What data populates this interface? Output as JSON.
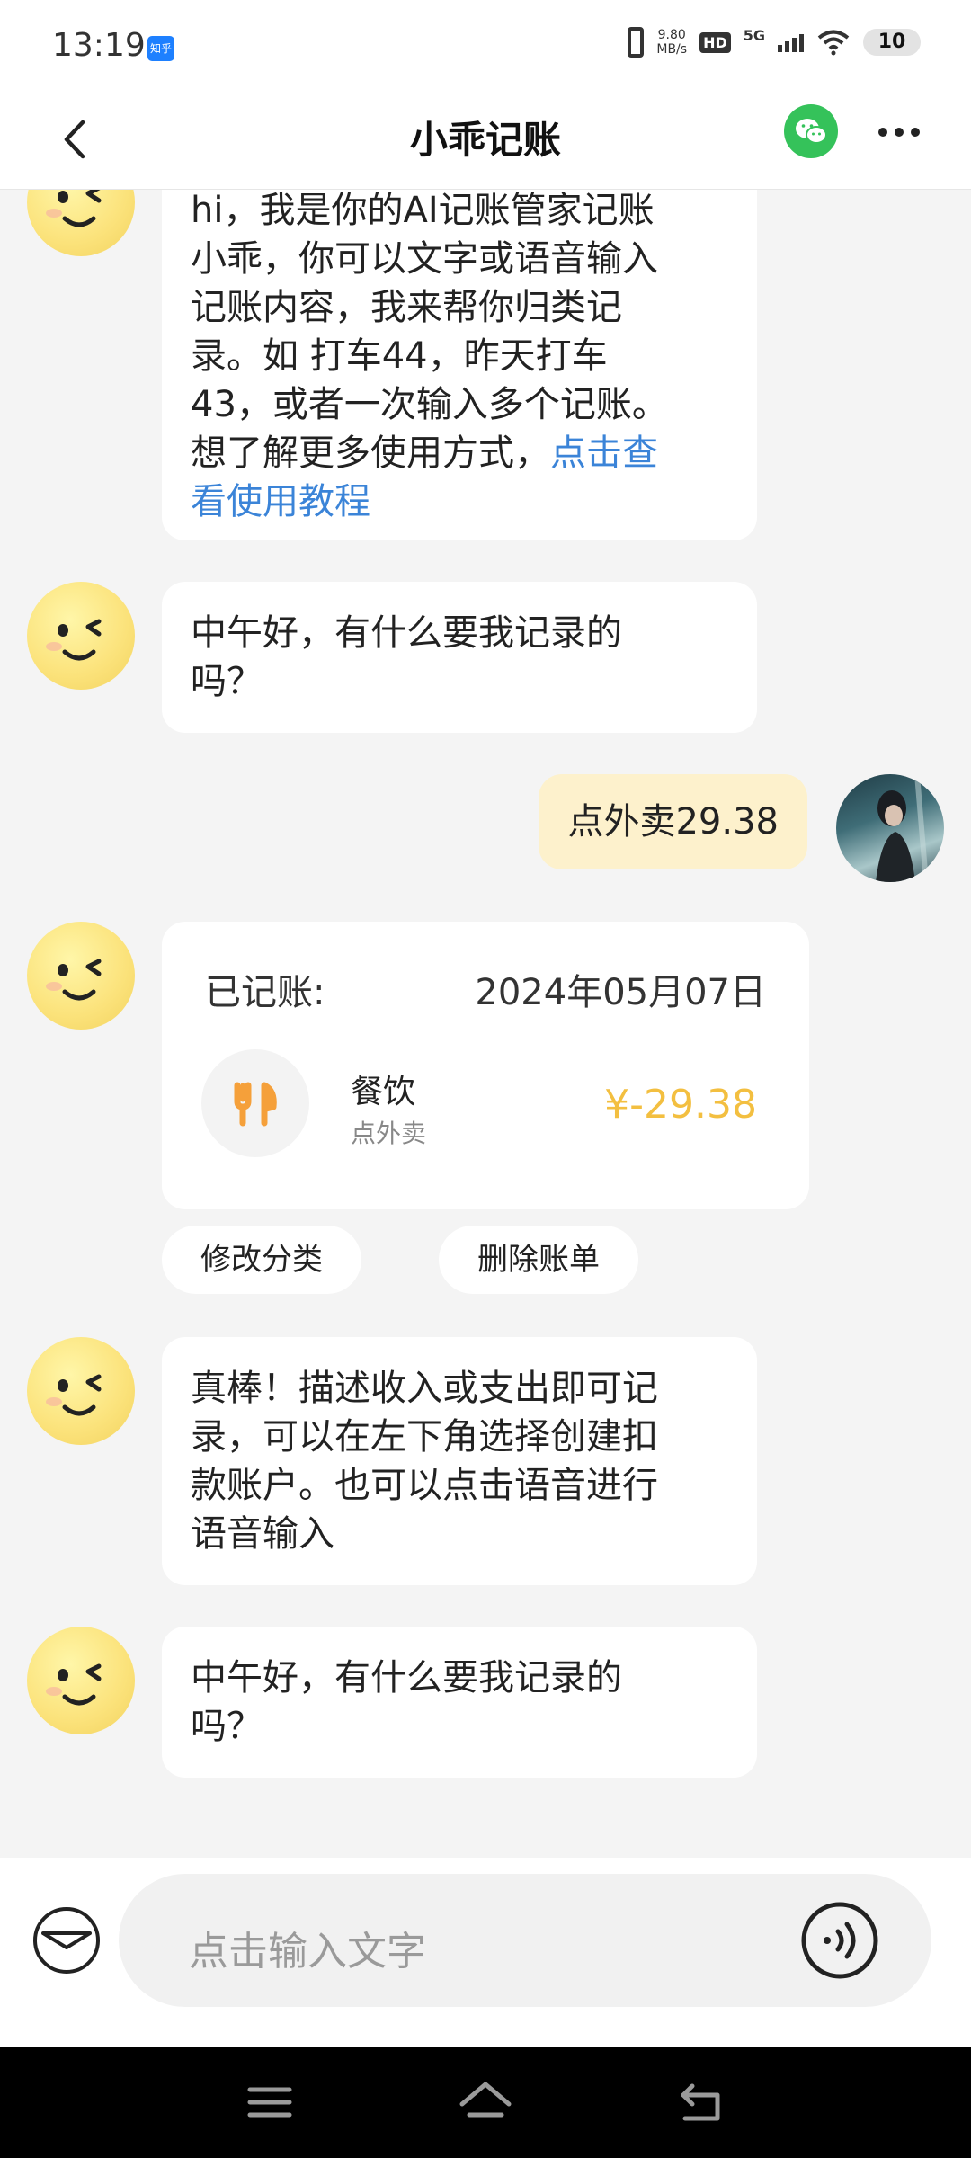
{
  "status_bar": {
    "time": "13:19",
    "app_badge": "知乎",
    "speed": "9.80",
    "speed_unit": "MB/s",
    "hd": "HD",
    "network": "5G",
    "battery": "10"
  },
  "header": {
    "title": "小乖记账",
    "icons": {
      "back": "chevron-left-icon",
      "share": "wechat-icon",
      "more": "more-dots-icon"
    }
  },
  "messages": {
    "intro": {
      "lines": [
        "hi，我是你的AI记账管家记账",
        "小乖，你可以文字或语音输入",
        "记账内容，我来帮你归类记",
        "录。如 打车44，昨天打车",
        "43，或者一次输入多个记账。"
      ],
      "last_line_prefix": "想了解更多使用方式，",
      "link_part1": "点击查",
      "link_part2": "看使用教程"
    },
    "greeting1": [
      "中午好，有什么要我记录的",
      "吗？"
    ],
    "user_msg": "点外卖29.38",
    "record_card": {
      "label": "已记账:",
      "date": "2024年05月07日",
      "category": "餐饮",
      "note": "点外卖",
      "amount": "¥-29.38",
      "amount_color": "#f3bf40",
      "category_icon": "fork-knife-icon"
    },
    "actions": {
      "edit": "修改分类",
      "delete": "删除账单"
    },
    "tip": [
      "真棒！描述收入或支出即可记",
      "录，可以在左下角选择创建扣",
      "款账户。也可以点击语音进行",
      "语音输入"
    ],
    "greeting2": [
      "中午好，有什么要我记录的",
      "吗？"
    ]
  },
  "input_bar": {
    "placeholder": "点击输入文字",
    "icons": {
      "wallet": "wallet-icon",
      "voice": "voice-icon"
    }
  },
  "nav_bar": {
    "icons": [
      "menu-icon",
      "home-icon",
      "back-icon"
    ]
  }
}
